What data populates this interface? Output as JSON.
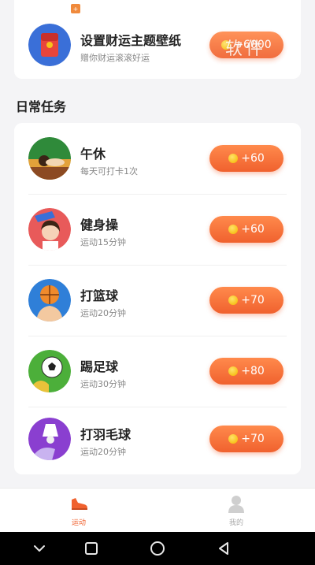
{
  "top_task": {
    "badge": "+",
    "title": "设置财运主题壁纸",
    "subtitle": "赠你财运滚滚好运",
    "reward": "+6000",
    "watermark": "软件"
  },
  "section": {
    "title": "日常任务"
  },
  "tasks": [
    {
      "title": "午休",
      "subtitle": "每天可打卡1次",
      "reward": "+60"
    },
    {
      "title": "健身操",
      "subtitle": "运动15分钟",
      "reward": "+60"
    },
    {
      "title": "打篮球",
      "subtitle": "运动20分钟",
      "reward": "+70"
    },
    {
      "title": "踢足球",
      "subtitle": "运动30分钟",
      "reward": "+80"
    },
    {
      "title": "打羽毛球",
      "subtitle": "运动20分钟",
      "reward": "+70"
    }
  ],
  "bottom_nav": {
    "sport_label": "运动",
    "mine_label": "我的"
  },
  "colors": {
    "accent": "#f0612e",
    "coin": "#f7c21b",
    "background": "#f4f4f6"
  },
  "icons": {
    "top_task": "red-envelope-icon",
    "nap": "nap-icon",
    "fitness": "fitness-icon",
    "basketball": "basketball-icon",
    "football": "football-icon",
    "badminton": "badminton-icon",
    "nav_sport": "sneaker-icon",
    "nav_mine": "user-icon"
  }
}
